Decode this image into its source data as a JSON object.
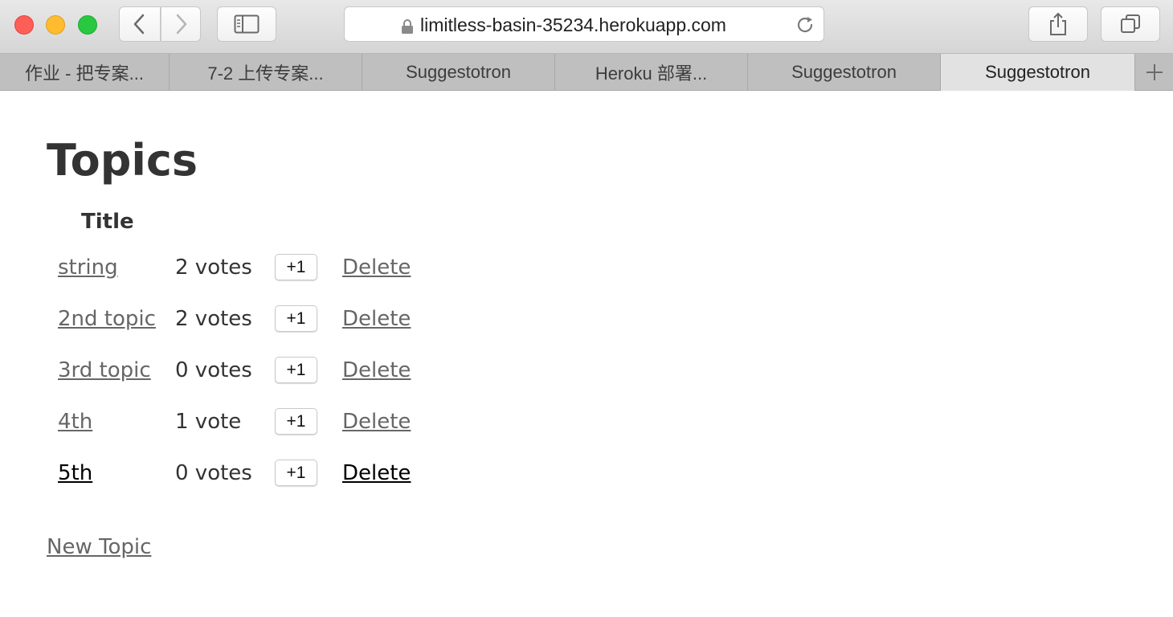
{
  "browser": {
    "url": "limitless-basin-35234.herokuapp.com",
    "tabs": [
      {
        "label": "作业 - 把专案..."
      },
      {
        "label": "7-2 上传专案..."
      },
      {
        "label": "Suggestotron"
      },
      {
        "label": "Heroku 部署..."
      },
      {
        "label": "Suggestotron"
      },
      {
        "label": "Suggestotron",
        "active": true
      }
    ]
  },
  "page": {
    "title": "Topics",
    "column_title": "Title",
    "vote_button_label": "+1",
    "delete_label": "Delete",
    "topics": [
      {
        "title": "string",
        "votes": "2 votes"
      },
      {
        "title": "2nd topic",
        "votes": "2 votes"
      },
      {
        "title": "3rd topic",
        "votes": "0 votes"
      },
      {
        "title": "4th",
        "votes": "1 vote"
      },
      {
        "title": "5th",
        "votes": "0 votes"
      }
    ],
    "new_topic_label": "New Topic"
  },
  "icons": {
    "back": "chevron-left-icon",
    "forward": "chevron-right-icon",
    "sidebar": "sidebar-icon",
    "lock": "lock-icon",
    "reload": "reload-icon",
    "share": "share-icon",
    "tabs": "tabs-overview-icon",
    "new_tab": "plus-icon"
  },
  "colors": {
    "link": "#666666",
    "link_hover": "#000000",
    "text": "#333333"
  }
}
